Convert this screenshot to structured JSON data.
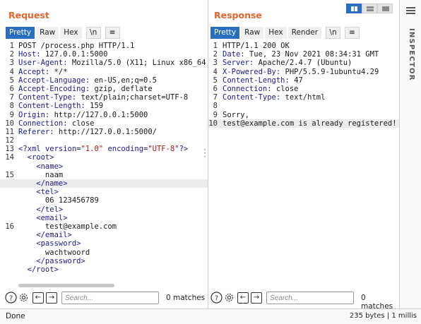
{
  "request": {
    "title": "Request",
    "tabs": [
      "Pretty",
      "Raw",
      "Hex"
    ],
    "newline_btn": "\\n",
    "menu_btn": "≡",
    "lines": [
      {
        "n": "1",
        "text": "POST /process.php HTTP/1.1"
      },
      {
        "n": "2",
        "key": "Host:",
        "val": " 127.0.0.1:5000"
      },
      {
        "n": "3",
        "key": "User-Agent:",
        "val": " Mozilla/5.0 (X11; Linux x86_64;"
      },
      {
        "n": "4",
        "key": "Accept:",
        "val": " */*"
      },
      {
        "n": "5",
        "key": "Accept-Language:",
        "val": " en-US,en;q=0.5"
      },
      {
        "n": "6",
        "key": "Accept-Encoding:",
        "val": " gzip, deflate"
      },
      {
        "n": "7",
        "key": "Content-Type:",
        "val": " text/plain;charset=UTF-8"
      },
      {
        "n": "8",
        "key": "Content-Length:",
        "val": " 159"
      },
      {
        "n": "9",
        "key": "Origin:",
        "val": " http://127.0.0.1:5000"
      },
      {
        "n": "10",
        "key": "Connection:",
        "val": " close"
      },
      {
        "n": "11",
        "key": "Referer:",
        "val": " http://127.0.0.1:5000/"
      },
      {
        "n": "12",
        "text": ""
      },
      {
        "n": "13",
        "xmldecl": true
      },
      {
        "n": "14",
        "text": "  <root>",
        "tag": true
      },
      {
        "n": "",
        "text": "    <name>",
        "tag": true
      },
      {
        "n": "15",
        "text": "      naam"
      },
      {
        "n": "",
        "text": "    </name>",
        "tag": true,
        "hl": true
      },
      {
        "n": "",
        "text": "    <tel>",
        "tag": true
      },
      {
        "n": "",
        "text": "      06 123456789"
      },
      {
        "n": "",
        "text": "    </tel>",
        "tag": true
      },
      {
        "n": "",
        "text": "    <email>",
        "tag": true
      },
      {
        "n": "16",
        "text": "      test@example.com"
      },
      {
        "n": "",
        "text": "    </email>",
        "tag": true
      },
      {
        "n": "",
        "text": "    <password>",
        "tag": true
      },
      {
        "n": "",
        "text": "      wachtwoord"
      },
      {
        "n": "",
        "text": "    </password>",
        "tag": true
      },
      {
        "n": "",
        "text": "  </root>",
        "tag": true
      }
    ],
    "xml": {
      "open": "<?xml ",
      "a1": "version=",
      "v1": "\"1.0\"",
      "a2": " encoding=",
      "v2": "\"UTF-8\"",
      "close": "?>"
    },
    "search_placeholder": "Search...",
    "matches": "0 matches"
  },
  "response": {
    "title": "Response",
    "tabs": [
      "Pretty",
      "Raw",
      "Hex",
      "Render"
    ],
    "newline_btn": "\\n",
    "menu_btn": "≡",
    "lines": [
      {
        "n": "1",
        "text": "HTTP/1.1 200 OK"
      },
      {
        "n": "2",
        "key": "Date:",
        "val": " Tue, 23 Nov 2021 08:34:31 GMT"
      },
      {
        "n": "3",
        "key": "Server:",
        "val": " Apache/2.4.7 (Ubuntu)"
      },
      {
        "n": "4",
        "key": "X-Powered-By:",
        "val": " PHP/5.5.9-1ubuntu4.29"
      },
      {
        "n": "5",
        "key": "Content-Length:",
        "val": " 47"
      },
      {
        "n": "6",
        "key": "Connection:",
        "val": " close"
      },
      {
        "n": "7",
        "key": "Content-Type:",
        "val": " text/html"
      },
      {
        "n": "8",
        "text": ""
      },
      {
        "n": "9",
        "text": "Sorry,"
      },
      {
        "n": "10",
        "text": "test@example.com is already registered!",
        "hl": true
      }
    ],
    "search_placeholder": "Search...",
    "matches": "0 matches"
  },
  "inspector": {
    "label": "INSPECTOR"
  },
  "status": {
    "left": "Done",
    "right": "235 bytes | 1 millis"
  },
  "colors": {
    "accent": "#e8632c",
    "active_tab": "#2a6ebf"
  }
}
